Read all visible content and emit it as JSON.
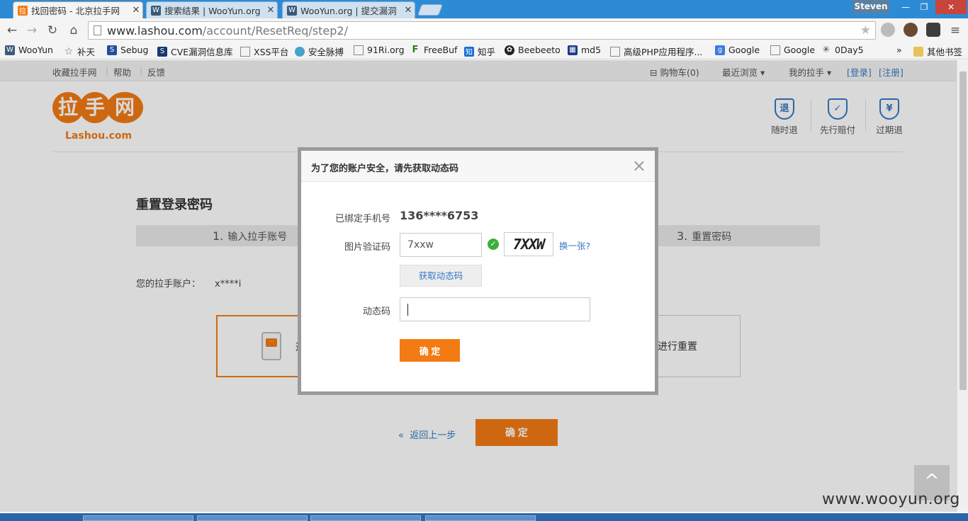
{
  "browser": {
    "tabs": [
      {
        "title": "找回密码 - 北京拉手网",
        "favicon": "lashou-icon",
        "active": true
      },
      {
        "title": "搜索结果 | WooYun.org",
        "favicon": "wooyun-icon",
        "active": false
      },
      {
        "title": "WooYun.org | 提交漏洞",
        "favicon": "wooyun-icon",
        "active": false
      }
    ],
    "user": "Steven",
    "url_host": "www.lashou.com",
    "url_path": "/account/ResetReq/step2/",
    "bookmarks": [
      "WooYun",
      "补天",
      "Sebug",
      "CVE漏洞信息库",
      "XSS平台",
      "安全脉搏",
      "91Ri.org",
      "FreeBuf",
      "知乎",
      "Beebeeto",
      "md5",
      "高级PHP应用程序...",
      "Google",
      "Google",
      "0Day5"
    ],
    "more_bookmarks": "»",
    "other_bookmarks": "其他书签"
  },
  "site": {
    "topbar_left": [
      "收藏拉手网",
      "帮助",
      "反馈"
    ],
    "cart": "购物车(0)",
    "recent": "最近浏览",
    "my": "我的拉手",
    "login": "[登录]",
    "register": "[注册]",
    "logo_cn": "拉手网",
    "logo_en": "Lashou.com",
    "guarantees": [
      {
        "icon": "退",
        "label": "随时退"
      },
      {
        "icon": "✓",
        "label": "先行赔付"
      },
      {
        "icon": "¥",
        "label": "过期退"
      }
    ]
  },
  "main": {
    "title": "重置登录密码",
    "step1_num": "1.",
    "step1_label": "输入拉手账号",
    "step3_num": "3.",
    "step3_label": "重置密码",
    "account_label": "您的拉手账户：",
    "account_value": "x****i",
    "option_left_text": "通",
    "option_right_text": "箱进行重置",
    "back_label": "返回上一步",
    "confirm_label": "确 定",
    "scroll_top": "^"
  },
  "modal": {
    "title": "为了您的账户安全，请先获取动态码",
    "close": "×",
    "phone_label": "已绑定手机号",
    "phone_value": "136****6753",
    "captcha_label": "图片验证码",
    "captcha_value": "7xxw",
    "captcha_image_text": "7XXW",
    "refresh_label": "换一张?",
    "get_code_label": "获取动态码",
    "code_label": "动态码",
    "code_value": "",
    "confirm_label": "确 定"
  },
  "watermark": "www.wooyun.org",
  "colors": {
    "brand_orange": "#f27b13",
    "link_blue": "#3478c2",
    "chrome_blue": "#2d8bd6"
  }
}
